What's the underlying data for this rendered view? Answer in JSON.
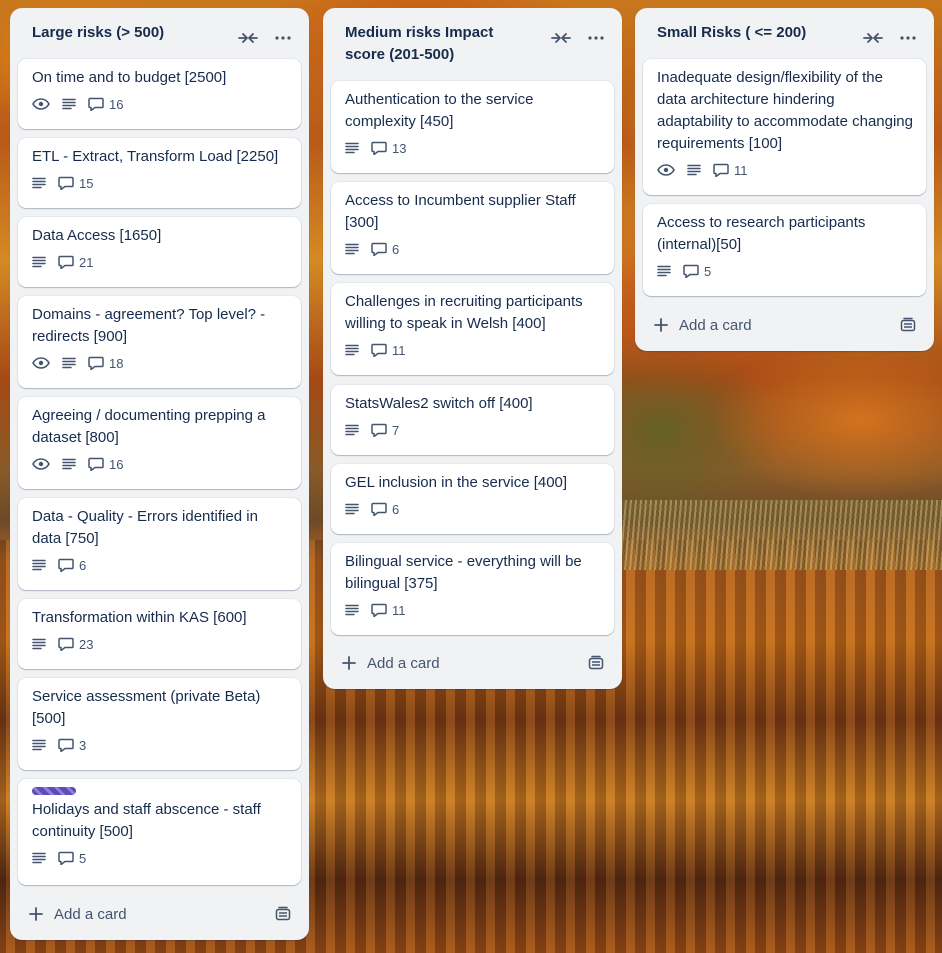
{
  "lists": [
    {
      "title": "Large risks (> 500)",
      "cards": [
        {
          "title": "On time and to budget [2500]",
          "comments": "16",
          "watch": true
        },
        {
          "title": "ETL - Extract, Transform Load [2250]",
          "comments": "15",
          "watch": false
        },
        {
          "title": "Data Access [1650]",
          "comments": "21",
          "watch": false
        },
        {
          "title": "Domains - agreement? Top level? - redirects [900]",
          "comments": "18",
          "watch": true
        },
        {
          "title": "Agreeing / documenting prepping a dataset [800]",
          "comments": "16",
          "watch": true
        },
        {
          "title": "Data - Quality - Errors identified in data [750]",
          "comments": "6",
          "watch": false
        },
        {
          "title": "Transformation within KAS [600]",
          "comments": "23",
          "watch": false
        },
        {
          "title": "Service assessment (private Beta) [500]",
          "comments": "3",
          "watch": false
        },
        {
          "title": "Holidays and staff abscence - staff continuity [500]",
          "comments": "5",
          "watch": false,
          "label_color": "#5e4db2"
        }
      ],
      "add_card": "Add a card"
    },
    {
      "title": "Medium risks Impact score (201-500)",
      "cards": [
        {
          "title": "Authentication to the service complexity [450]",
          "comments": "13",
          "watch": false
        },
        {
          "title": "Access to Incumbent supplier Staff [300]",
          "comments": "6",
          "watch": false
        },
        {
          "title": "Challenges in recruiting participants willing to speak in Welsh [400]",
          "comments": "11",
          "watch": false
        },
        {
          "title": "StatsWales2 switch off [400]",
          "comments": "7",
          "watch": false
        },
        {
          "title": "GEL inclusion in the service [400]",
          "comments": "6",
          "watch": false
        },
        {
          "title": "Bilingual service - everything will be bilingual [375]",
          "comments": "11",
          "watch": false
        }
      ],
      "add_card": "Add a card"
    },
    {
      "title": "Small Risks ( <= 200)",
      "cards": [
        {
          "title": "Inadequate design/flexibility of the data architecture hindering adaptability to accommodate changing requirements [100]",
          "comments": "11",
          "watch": true
        },
        {
          "title": "Access to research participants (internal)[50]",
          "comments": "5",
          "watch": false
        }
      ],
      "add_card": "Add a card"
    }
  ],
  "icons": {
    "collapse": "collapse-arrows-icon",
    "menu": "more-horizontal-icon",
    "watch": "eye-icon",
    "description": "description-lines-icon",
    "comments": "comment-bubble-icon",
    "add": "plus-icon",
    "template": "card-template-icon"
  },
  "colors": {
    "list_bg": "#f1f2f4",
    "card_bg": "#ffffff",
    "text": "#172b4d",
    "muted": "#44546f"
  }
}
